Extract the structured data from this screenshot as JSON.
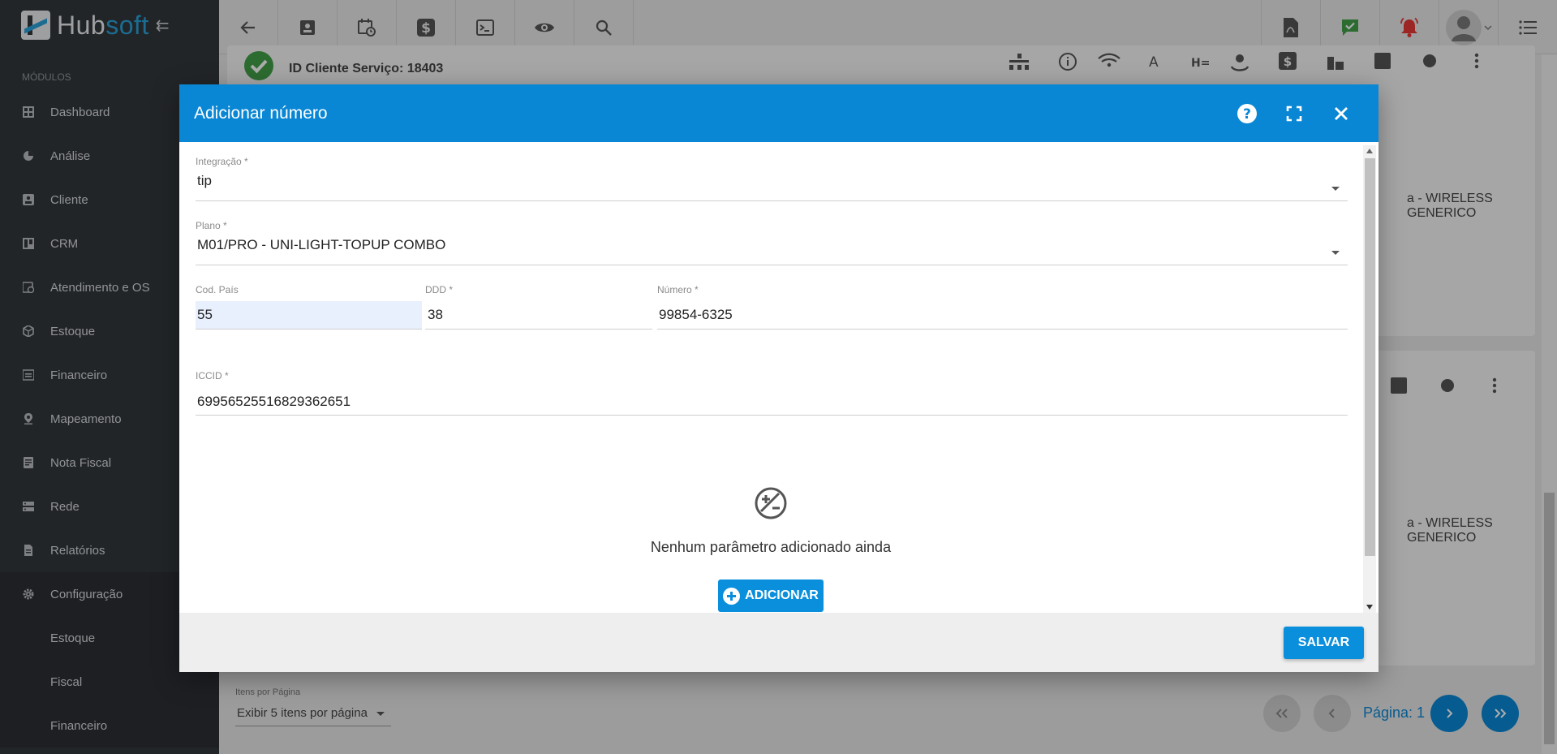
{
  "app": {
    "logo_primary": "Hub",
    "logo_accent": "soft"
  },
  "sidebar": {
    "section_title": "MÓDULOS",
    "items": [
      {
        "label": "Dashboard",
        "icon": "dashboard-icon"
      },
      {
        "label": "Análise",
        "icon": "pie-chart-icon"
      },
      {
        "label": "Cliente",
        "icon": "contact-card-icon"
      },
      {
        "label": "CRM",
        "icon": "crm-board-icon"
      },
      {
        "label": "Atendimento e OS",
        "icon": "calendar-clock-icon"
      },
      {
        "label": "Estoque",
        "icon": "cube-icon"
      },
      {
        "label": "Financeiro",
        "icon": "money-icon"
      },
      {
        "label": "Mapeamento",
        "icon": "map-pin-icon"
      },
      {
        "label": "Nota Fiscal",
        "icon": "invoice-icon"
      },
      {
        "label": "Rede",
        "icon": "server-icon"
      },
      {
        "label": "Relatórios",
        "icon": "report-icon"
      },
      {
        "label": "Configuração",
        "icon": "gear-icon"
      }
    ],
    "sub_items": [
      {
        "label": "Estoque"
      },
      {
        "label": "Fiscal"
      },
      {
        "label": "Financeiro"
      }
    ]
  },
  "background": {
    "service_id_label": "ID Cliente Serviço: 18403",
    "row_text_1": "a - WIRELESS GENERICO",
    "row_text_2": "a - WIRELESS GENERICO",
    "items_per_page_label": "Itens por Página",
    "items_per_page_value": "Exibir 5 itens por página",
    "page_label": "Página: 1"
  },
  "modal": {
    "title": "Adicionar número",
    "fields": {
      "integracao": {
        "label": "Integração *",
        "value": "tip"
      },
      "plano": {
        "label": "Plano *",
        "value": "M01/PRO - UNI-LIGHT-TOPUP COMBO"
      },
      "cod_pais": {
        "label": "Cod. País",
        "value": "55"
      },
      "ddd": {
        "label": "DDD *",
        "value": "38"
      },
      "numero": {
        "label": "Número *",
        "value": "99854-6325"
      },
      "iccid": {
        "label": "ICCID *",
        "value": "69956525516829362651"
      }
    },
    "empty_state": "Nenhum parâmetro adicionado ainda",
    "add_button": "ADICIONAR",
    "save_button": "SALVAR"
  },
  "colors": {
    "primary": "#0a87d4",
    "sidebar": "#33373c",
    "alert": "#e53935",
    "success": "#43a047"
  }
}
